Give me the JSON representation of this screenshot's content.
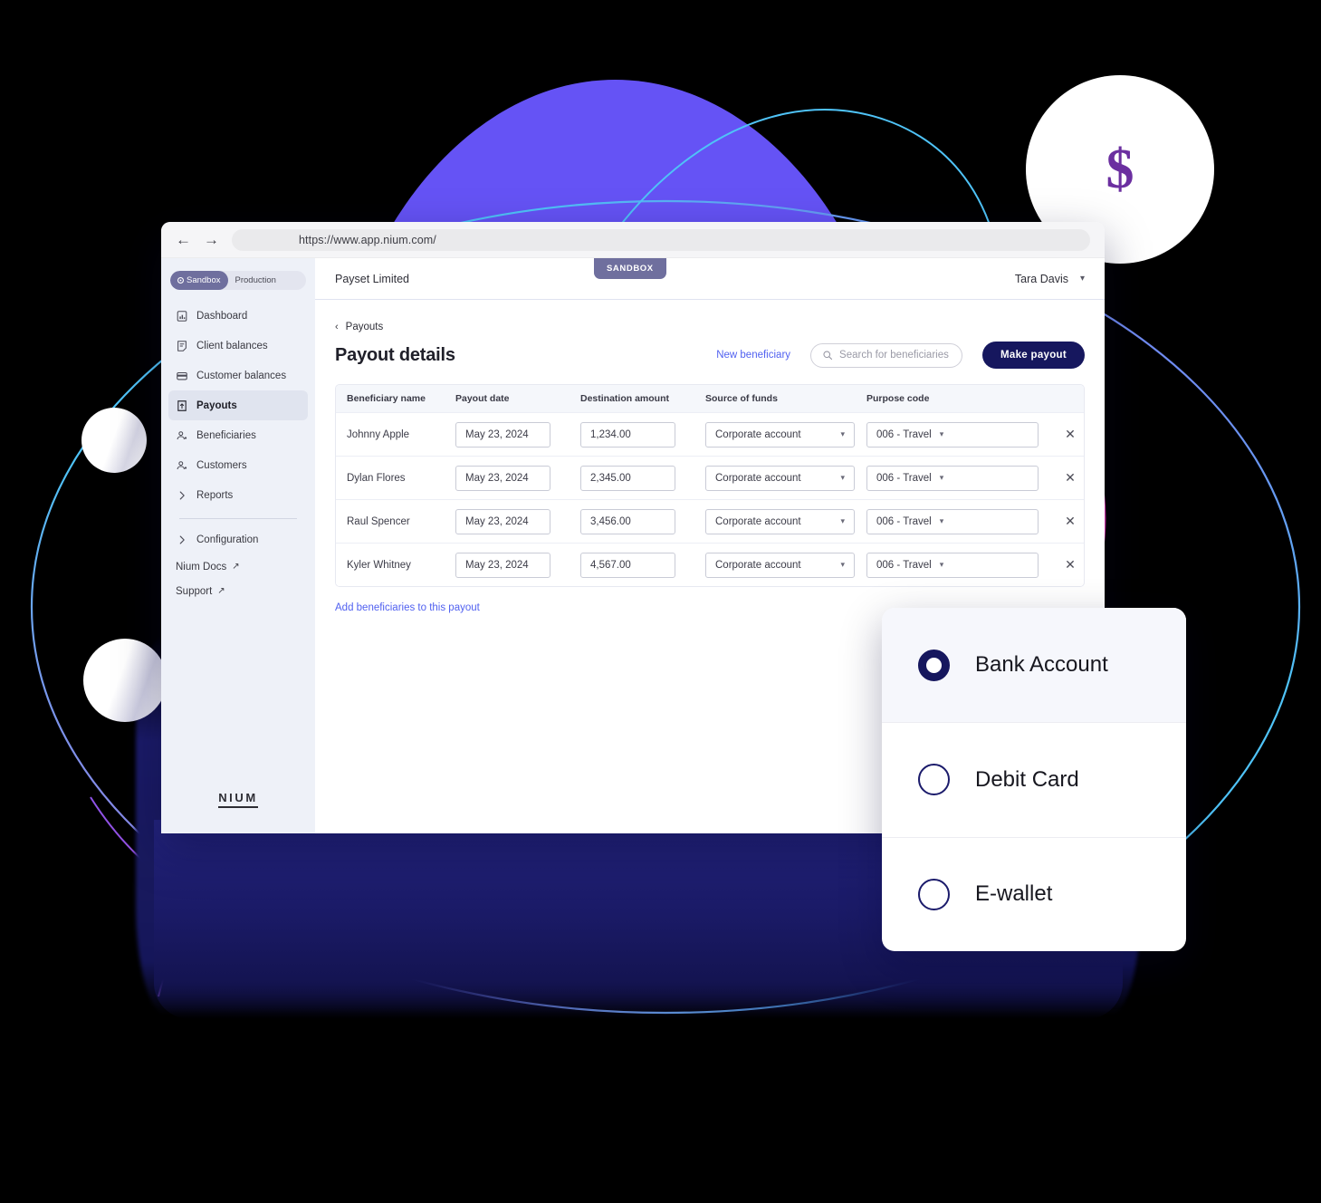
{
  "browser": {
    "url": "https://www.app.nium.com/",
    "back_icon": "arrow-left-icon",
    "forward_icon": "arrow-right-icon"
  },
  "sidebar": {
    "env_toggle": {
      "sandbox_label": "Sandbox",
      "production_label": "Production",
      "selected": "Sandbox"
    },
    "items": [
      {
        "label": "Dashboard",
        "icon": "chart-icon",
        "active": false
      },
      {
        "label": "Client balances",
        "icon": "note-icon",
        "active": false
      },
      {
        "label": "Customer balances",
        "icon": "wallet-icon",
        "active": false
      },
      {
        "label": "Payouts",
        "icon": "payout-icon",
        "active": true
      },
      {
        "label": "Beneficiaries",
        "icon": "people-icon",
        "active": false
      },
      {
        "label": "Customers",
        "icon": "people-icon",
        "active": false
      },
      {
        "label": "Reports",
        "icon": "chevron-right-icon",
        "active": false
      }
    ],
    "group_items": [
      {
        "label": "Configuration",
        "icon": "chevron-right-icon"
      }
    ],
    "links": [
      {
        "label": "Nium Docs",
        "icon": "external-link-icon"
      },
      {
        "label": "Support",
        "icon": "external-link-icon"
      }
    ],
    "brand": "NIUM"
  },
  "topbar": {
    "sandbox_badge": "SANDBOX",
    "org_name": "Payset Limited",
    "user_name": "Tara Davis",
    "user_caret_icon": "chevron-down-icon"
  },
  "page": {
    "breadcrumb": "Payouts",
    "breadcrumb_icon": "chevron-left-icon",
    "title": "Payout details",
    "new_beneficiary_label": "New beneficiary",
    "search_placeholder": "Search for beneficiaries",
    "search_icon": "search-icon",
    "make_payout_label": "Make  payout",
    "add_beneficiaries_label": "Add beneficiaries to this payout"
  },
  "table": {
    "columns": [
      "Beneficiary name",
      "Payout date",
      "Destination amount",
      "Source of funds",
      "Purpose code"
    ],
    "rows": [
      {
        "name": "Johnny Apple",
        "date": "May 23, 2024",
        "amount": "1,234.00",
        "source": "Corporate account",
        "purpose": "006 - Travel",
        "delete_icon": "close-icon"
      },
      {
        "name": "Dylan Flores",
        "date": "May 23, 2024",
        "amount": "2,345.00",
        "source": "Corporate account",
        "purpose": "006 - Travel",
        "delete_icon": "close-icon"
      },
      {
        "name": "Raul Spencer",
        "date": "May 23, 2024",
        "amount": "3,456.00",
        "source": "Corporate account",
        "purpose": "006 - Travel",
        "delete_icon": "close-icon"
      },
      {
        "name": "Kyler Whitney",
        "date": "May 23, 2024",
        "amount": "4,567.00",
        "source": "Corporate account",
        "purpose": "006 - Travel",
        "delete_icon": "close-icon"
      }
    ]
  },
  "payout_method_card": {
    "options": [
      {
        "label": "Bank Account",
        "selected": true
      },
      {
        "label": "Debit Card",
        "selected": false
      },
      {
        "label": "E-wallet",
        "selected": false
      }
    ]
  },
  "decoration": {
    "dollar_glyph": "$",
    "colors": {
      "purple_blob": "#6553F5",
      "navy": "#16175E",
      "accent_blue": "#5161f0",
      "cyan_line": "#3ec6f0",
      "pink_line": "#e53bb4",
      "violet_line": "#9a5bf0",
      "dollar_purple": "#6B2FA0",
      "badge_purple": "#6f6f9e"
    }
  }
}
